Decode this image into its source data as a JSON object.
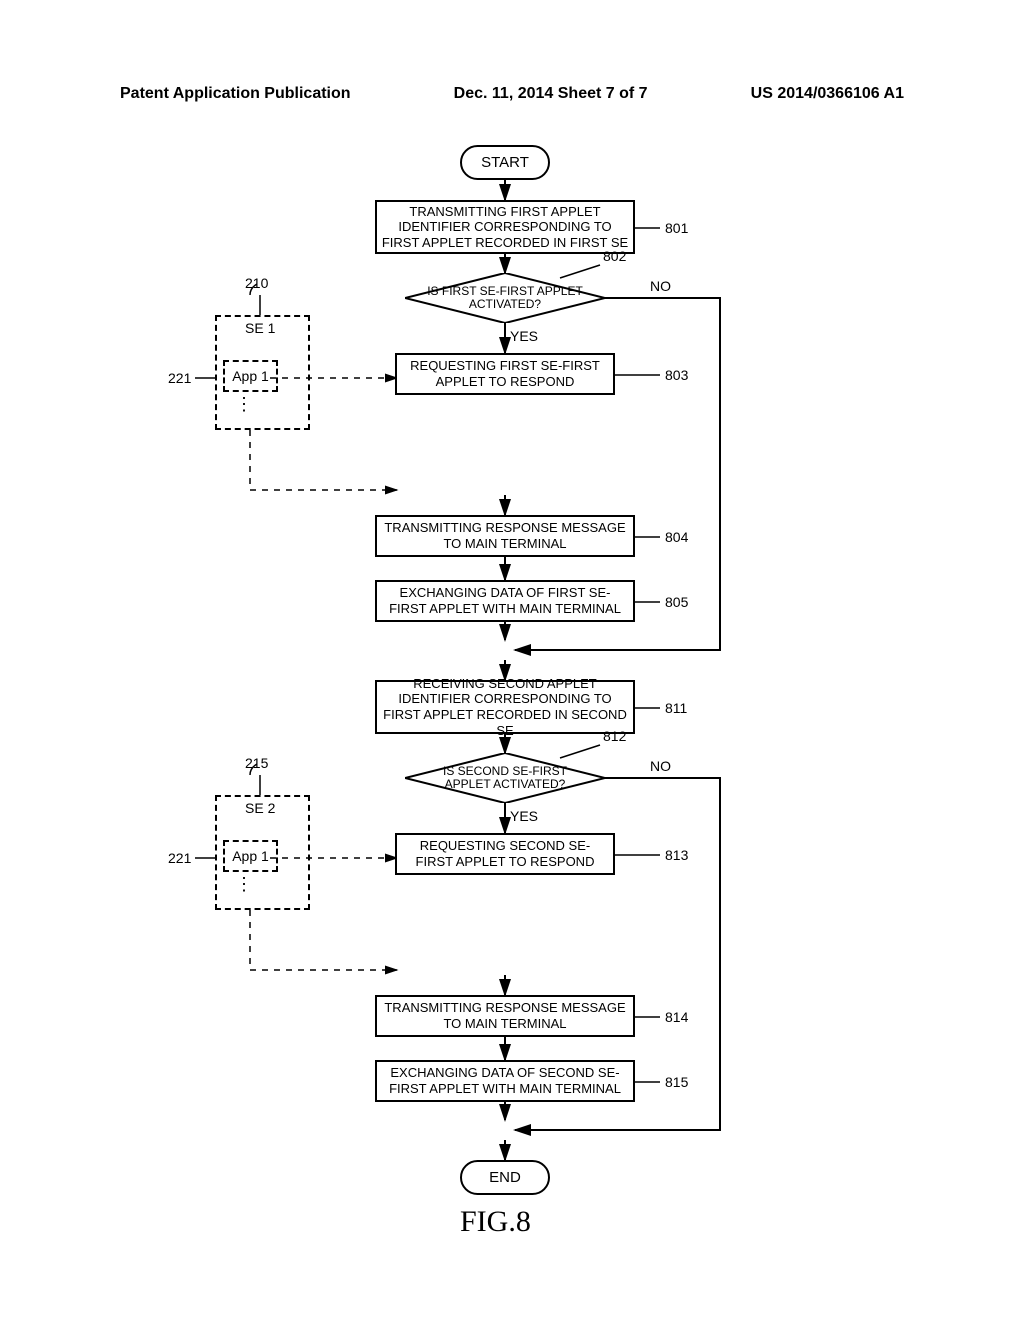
{
  "header": {
    "left": "Patent Application Publication",
    "center": "Dec. 11, 2014  Sheet 7 of 7",
    "right": "US 2014/0366106 A1"
  },
  "flow": {
    "start": "START",
    "end": "END",
    "b801": "TRANSMITTING FIRST APPLET IDENTIFIER CORRESPONDING TO FIRST APPLET RECORDED IN FIRST SE",
    "d802": "IS FIRST SE-FIRST APPLET ACTIVATED?",
    "b803": "REQUESTING FIRST SE-FIRST APPLET TO RESPOND",
    "b804": "TRANSMITTING RESPONSE MESSAGE TO MAIN TERMINAL",
    "b805": "EXCHANGING DATA OF FIRST SE-FIRST APPLET WITH MAIN TERMINAL",
    "b811": "RECEIVING SECOND APPLET IDENTIFIER CORRESPONDING TO FIRST APPLET RECORDED IN SECOND SE",
    "d812": "IS SECOND SE-FIRST APPLET ACTIVATED?",
    "b813": "REQUESTING SECOND SE-FIRST APPLET TO RESPOND",
    "b814": "TRANSMITTING RESPONSE MESSAGE TO MAIN TERMINAL",
    "b815": "EXCHANGING DATA OF SECOND SE-FIRST APPLET WITH MAIN TERMINAL"
  },
  "refs": {
    "r801": "801",
    "r802": "802",
    "r803": "803",
    "r804": "804",
    "r805": "805",
    "r811": "811",
    "r812": "812",
    "r813": "813",
    "r814": "814",
    "r815": "815",
    "r210": "210",
    "r215": "215",
    "r221a": "221",
    "r221b": "221"
  },
  "branches": {
    "yes": "YES",
    "no": "NO"
  },
  "se": {
    "se1": "SE 1",
    "se2": "SE 2",
    "app1": "App 1"
  },
  "figure": "FIG.8"
}
